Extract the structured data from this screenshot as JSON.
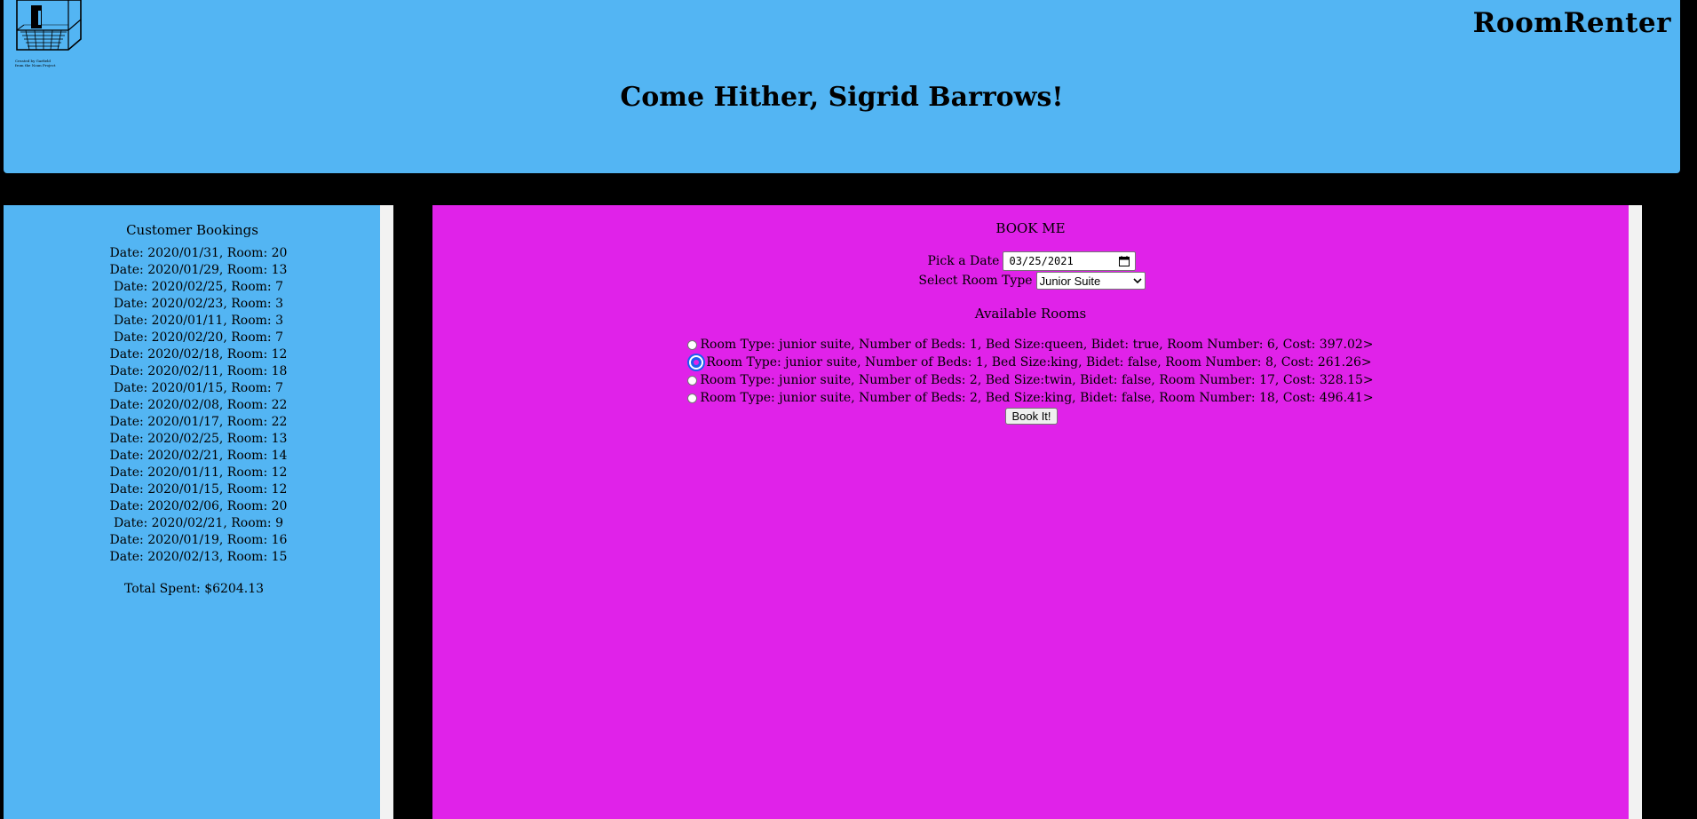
{
  "header": {
    "brand": "RoomRenter",
    "greeting": "Come Hither, Sigrid Barrows!",
    "logo_caption_1": "Created by Garfield",
    "logo_caption_2": "from the Noun Project",
    "background_color": "#53b5f3"
  },
  "sidebar": {
    "title": "Customer Bookings",
    "bookings": [
      "Date: 2020/01/31, Room: 20",
      "Date: 2020/01/29, Room: 13",
      "Date: 2020/02/25, Room: 7",
      "Date: 2020/02/23, Room: 3",
      "Date: 2020/01/11, Room: 3",
      "Date: 2020/02/20, Room: 7",
      "Date: 2020/02/18, Room: 12",
      "Date: 2020/02/11, Room: 18",
      "Date: 2020/01/15, Room: 7",
      "Date: 2020/02/08, Room: 22",
      "Date: 2020/01/17, Room: 22",
      "Date: 2020/02/25, Room: 13",
      "Date: 2020/02/21, Room: 14",
      "Date: 2020/01/11, Room: 12",
      "Date: 2020/01/15, Room: 12",
      "Date: 2020/02/06, Room: 20",
      "Date: 2020/02/21, Room: 9",
      "Date: 2020/01/19, Room: 16",
      "Date: 2020/02/13, Room: 15"
    ],
    "total": "Total Spent: $6204.13"
  },
  "main": {
    "title": "BOOK ME",
    "date_label": "Pick a Date",
    "date_value": "03/25/2021",
    "room_type_label": "Select Room Type",
    "room_type_value": "Junior Suite",
    "available_title": "Available Rooms",
    "rooms": [
      {
        "text": "Room Type: junior suite, Number of Beds: 1, Bed Size:queen, Bidet: true, Room Number: 6, Cost: 397.02>",
        "selected": false
      },
      {
        "text": "Room Type: junior suite, Number of Beds: 1, Bed Size:king, Bidet: false, Room Number: 8, Cost: 261.26>",
        "selected": true
      },
      {
        "text": "Room Type: junior suite, Number of Beds: 2, Bed Size:twin, Bidet: false, Room Number: 17, Cost: 328.15>",
        "selected": false
      },
      {
        "text": "Room Type: junior suite, Number of Beds: 2, Bed Size:king, Bidet: false, Room Number: 18, Cost: 496.41>",
        "selected": false
      }
    ],
    "book_button": "Book It!",
    "background_color": "#e022e9"
  }
}
